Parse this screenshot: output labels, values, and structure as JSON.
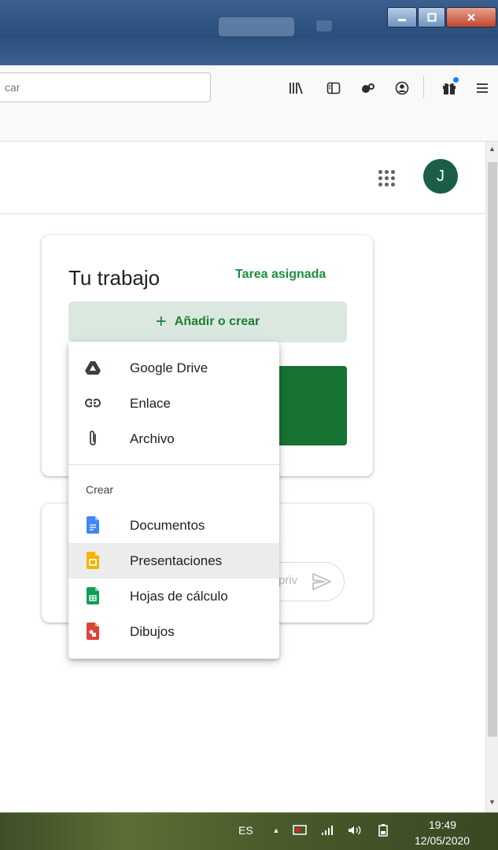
{
  "browser": {
    "url_partial": "car",
    "toolbar_icons": [
      "library-icon",
      "sidebar-icon",
      "extensions-icon",
      "account-icon",
      "gift-icon",
      "menu-icon"
    ],
    "window_controls": [
      "minimize",
      "maximize",
      "close"
    ]
  },
  "app_header": {
    "avatar_initial": "J"
  },
  "work_card": {
    "title": "Tu trabajo",
    "status": "Tarea asignada",
    "add_button": "Añadir o crear"
  },
  "comment_card": {
    "placeholder_partial": "priv"
  },
  "add_menu": {
    "items": [
      {
        "label": "Google Drive",
        "icon": "drive-icon"
      },
      {
        "label": "Enlace",
        "icon": "link-icon"
      },
      {
        "label": "Archivo",
        "icon": "paperclip-icon"
      }
    ],
    "create_header": "Crear",
    "create_items": [
      {
        "label": "Documentos",
        "icon": "docs-icon",
        "color": "#4285f4"
      },
      {
        "label": "Presentaciones",
        "icon": "slides-icon",
        "color": "#f4b400",
        "highlighted": true
      },
      {
        "label": "Hojas de cálculo",
        "icon": "sheets-icon",
        "color": "#0f9d58"
      },
      {
        "label": "Dibujos",
        "icon": "drawings-icon",
        "color": "#db4437"
      }
    ]
  },
  "taskbar": {
    "language": "ES",
    "time": "19:49",
    "date": "12/05/2020"
  },
  "colors": {
    "accent_green": "#1e8e3e",
    "avatar_bg": "#1b5e45",
    "add_button_bg": "#dbe8df"
  }
}
